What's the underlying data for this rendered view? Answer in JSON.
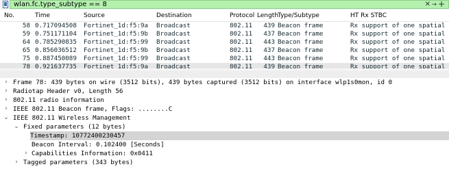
{
  "filter": {
    "value": "wlan.fc.type_subtype == 8",
    "clear_glyph": "✕",
    "dropdown_glyph": "→",
    "add_glyph": "+"
  },
  "columns": {
    "no": "No.",
    "time": "Time",
    "source": "Source",
    "destination": "Destination",
    "protocol": "Protocol",
    "length": "Length",
    "type_subtype": "Type/Subtype",
    "ht_rx_stbc": "HT Rx STBC"
  },
  "packets": [
    {
      "no": "58",
      "time": "0.717094508",
      "source": "Fortinet_1d:f5:9a",
      "destination": "Broadcast",
      "protocol": "802.11",
      "length": "439",
      "type": "Beacon frame",
      "stbc": "Rx support of one spatial st"
    },
    {
      "no": "59",
      "time": "0.751171104",
      "source": "Fortinet_1d:f5:9b",
      "destination": "Broadcast",
      "protocol": "802.11",
      "length": "437",
      "type": "Beacon frame",
      "stbc": "Rx support of one spatial st"
    },
    {
      "no": "64",
      "time": "0.785290835",
      "source": "Fortinet_1d:f5:99",
      "destination": "Broadcast",
      "protocol": "802.11",
      "length": "443",
      "type": "Beacon frame",
      "stbc": "Rx support of one spatial st"
    },
    {
      "no": "65",
      "time": "0.856036512",
      "source": "Fortinet_1d:f5:9b",
      "destination": "Broadcast",
      "protocol": "802.11",
      "length": "437",
      "type": "Beacon frame",
      "stbc": "Rx support of one spatial st"
    },
    {
      "no": "75",
      "time": "0.887450089",
      "source": "Fortinet_1d:f5:99",
      "destination": "Broadcast",
      "protocol": "802.11",
      "length": "443",
      "type": "Beacon frame",
      "stbc": "Rx support of one spatial st"
    },
    {
      "no": "78",
      "time": "0.921637735",
      "source": "Fortinet_1d:f5:9a",
      "destination": "Broadcast",
      "protocol": "802.11",
      "length": "439",
      "type": "Beacon frame",
      "stbc": "Rx support of one spatial st"
    }
  ],
  "details": [
    {
      "arrow": "›",
      "label": "Frame 78: 439 bytes on wire (3512 bits), 439 bytes captured (3512 bits) on interface wlp1s0mon, id 0"
    },
    {
      "arrow": "›",
      "label": "Radiotap Header v0, Length 56"
    },
    {
      "arrow": "›",
      "label": "802.11 radio information"
    },
    {
      "arrow": "›",
      "label": "IEEE 802.11 Beacon frame, Flags: ........C"
    },
    {
      "arrow": "⌄",
      "label": "IEEE 802.11 Wireless Management"
    },
    {
      "arrow": "⌄",
      "label": "Fixed parameters (12 bytes)"
    },
    {
      "arrow": "",
      "label": "Timestamp: 10772400230457"
    },
    {
      "arrow": "",
      "label": "Beacon Interval: 0.102400 [Seconds]"
    },
    {
      "arrow": "›",
      "label": "Capabilities Information: 0x0411"
    },
    {
      "arrow": "›",
      "label": "Tagged parameters (343 bytes)"
    }
  ]
}
